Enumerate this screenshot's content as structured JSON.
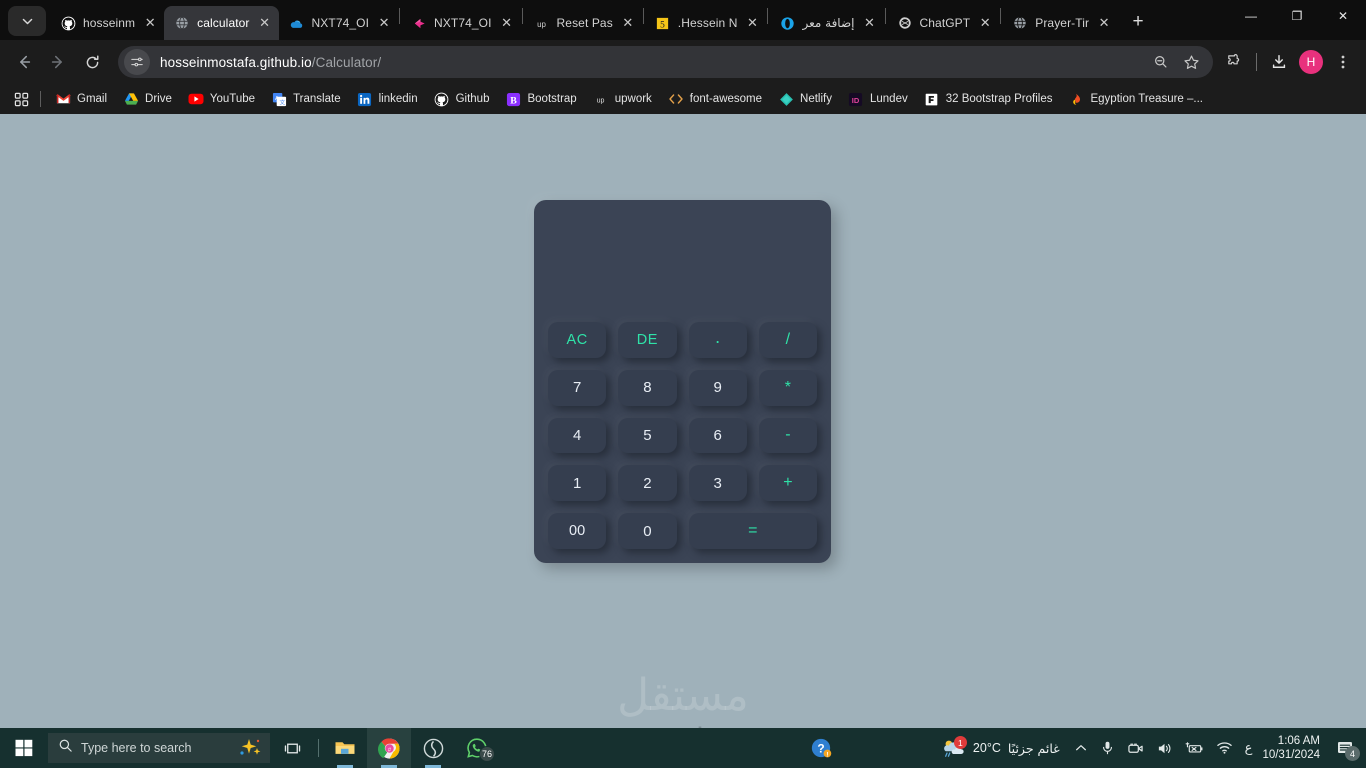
{
  "browser": {
    "tabs": [
      {
        "label": "hosseinm",
        "favicon": "github-icon",
        "active": false
      },
      {
        "label": "calculator",
        "favicon": "globe-icon",
        "active": true
      },
      {
        "label": "NXT74_OI",
        "favicon": "onedrive-cloud-icon",
        "active": false
      },
      {
        "label": "NXT74_OI",
        "favicon": "figma-arrow-icon",
        "active": false
      },
      {
        "label": "Reset Pas",
        "favicon": "upwork-icon",
        "active": false
      },
      {
        "label": ".Hessein N",
        "favicon": "yellow-5-icon",
        "active": false
      },
      {
        "label": "إضافة معر",
        "favicon": "opera-o-icon",
        "active": false
      },
      {
        "label": "ChatGPT",
        "favicon": "openai-icon",
        "active": false
      },
      {
        "label": "Prayer-Tir",
        "favicon": "globe-icon",
        "active": false
      }
    ],
    "new_tab_label": "+",
    "tab_close_label": "✕",
    "window_controls": {
      "minimize": "—",
      "maximize": "❐",
      "close": "✕"
    },
    "nav": {
      "back": "←",
      "forward": "→",
      "reload": "⟳"
    },
    "omnibox": {
      "site_info_icon": "tune-icon",
      "url_domain": "hosseinmostafa.github.io",
      "url_path": "/Calculator/",
      "zoom_icon": "zoom-out-icon",
      "bookmark_icon": "star-icon"
    },
    "toolbar_right": {
      "extensions_icon": "puzzle-icon",
      "downloads_icon": "download-icon",
      "profile_initial": "H",
      "menu_icon": "three-dots-icon"
    },
    "bookmarks": {
      "apps_icon": "apps-grid-icon",
      "items": [
        {
          "label": "Gmail",
          "icon": "gmail-icon"
        },
        {
          "label": "Drive",
          "icon": "google-drive-icon"
        },
        {
          "label": "YouTube",
          "icon": "youtube-icon"
        },
        {
          "label": "Translate",
          "icon": "google-translate-icon"
        },
        {
          "label": "linkedin",
          "icon": "linkedin-icon"
        },
        {
          "label": "Github",
          "icon": "github-icon"
        },
        {
          "label": "Bootstrap",
          "icon": "bootstrap-icon"
        },
        {
          "label": "upwork",
          "icon": "upwork-icon"
        },
        {
          "label": "font-awesome",
          "icon": "code-brackets-icon"
        },
        {
          "label": "Netlify",
          "icon": "netlify-icon"
        },
        {
          "label": "Lundev",
          "icon": "lundev-icon"
        },
        {
          "label": "32 Bootstrap Profiles",
          "icon": "figma-file-icon"
        },
        {
          "label": "Egyption Treasure –...",
          "icon": "flame-icon"
        }
      ]
    }
  },
  "calculator": {
    "display": {
      "previous": "",
      "current": ""
    },
    "keys": [
      {
        "label": "AC",
        "kind": "fn"
      },
      {
        "label": "DE",
        "kind": "fn"
      },
      {
        "label": ".",
        "kind": "dot"
      },
      {
        "label": "/",
        "kind": "op"
      },
      {
        "label": "7",
        "kind": "num"
      },
      {
        "label": "8",
        "kind": "num"
      },
      {
        "label": "9",
        "kind": "num"
      },
      {
        "label": "*",
        "kind": "op"
      },
      {
        "label": "4",
        "kind": "num"
      },
      {
        "label": "5",
        "kind": "num"
      },
      {
        "label": "6",
        "kind": "num"
      },
      {
        "label": "-",
        "kind": "op"
      },
      {
        "label": "1",
        "kind": "num"
      },
      {
        "label": "2",
        "kind": "num"
      },
      {
        "label": "3",
        "kind": "num"
      },
      {
        "label": "+",
        "kind": "op"
      },
      {
        "label": "00",
        "kind": "zero-zero"
      },
      {
        "label": "0",
        "kind": "num"
      },
      {
        "label": "=",
        "kind": "eq"
      }
    ],
    "colors": {
      "page_background": "#9fb1ba",
      "body": "#3b4455",
      "key": "#353e4f",
      "accent": "#2fe2a8",
      "number_text": "#e9eef5"
    }
  },
  "watermark": {
    "arabic": "مستقل",
    "latin": "mostaql.com"
  },
  "taskbar": {
    "start_icon": "windows-start-icon",
    "search_placeholder": "Type here to search",
    "search_icon": "magnifier-icon",
    "copilot_icon": "copilot-sparkle-icon",
    "task_view_icon": "task-view-icon",
    "widgets_icon": "widgets-icon",
    "apps": [
      {
        "name": "file-explorer-icon"
      },
      {
        "name": "chrome-icon"
      },
      {
        "name": "sound-app-icon"
      },
      {
        "name": "whatsapp-icon",
        "badge": "76"
      }
    ],
    "help_icon": "help-circle-icon",
    "weather": {
      "icon": "partly-cloudy-icon",
      "badge": "1",
      "temperature": "20°C",
      "condition": "غائم جزئيًا"
    },
    "tray": {
      "chevron_icon": "chevron-up-icon",
      "microphone_icon": "microphone-icon",
      "camera_icon": "camera-icon",
      "volume_icon": "speaker-icon",
      "battery_icon": "battery-no-icon",
      "network_icon": "wifi-icon",
      "language": "ع"
    },
    "clock": {
      "time": "1:06 AM",
      "date": "10/31/2024"
    },
    "notifications": {
      "icon": "notification-icon",
      "count": "4"
    }
  }
}
